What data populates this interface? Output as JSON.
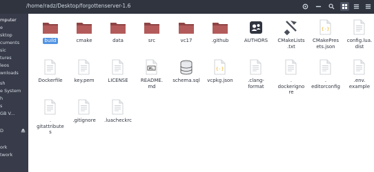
{
  "toolbar": {
    "path": "/home/radz/Desktop/forgottenserver-1.6",
    "buttons": [
      {
        "name": "view-options-icon"
      },
      {
        "name": "zoom-out-icon"
      },
      {
        "name": "search-icon"
      },
      {
        "name": "icon-view-icon"
      },
      {
        "name": "list-view-icon"
      },
      {
        "name": "menu-icon"
      }
    ]
  },
  "sidebar": {
    "items": [
      "mputer",
      "e",
      "sktop",
      "cuments",
      "sic",
      "tures",
      "leos",
      "wnloads",
      "sh",
      "e System",
      "h",
      "s",
      "GB V...",
      "D",
      "ork",
      "twork"
    ]
  },
  "files": [
    {
      "label": "build",
      "type": "folder",
      "selected": true
    },
    {
      "label": "cmake",
      "type": "folder"
    },
    {
      "label": "data",
      "type": "folder"
    },
    {
      "label": "src",
      "type": "folder"
    },
    {
      "label": "vc17",
      "type": "folder"
    },
    {
      "label": ".github",
      "type": "folder"
    },
    {
      "label": "AUTHORS",
      "type": "authors"
    },
    {
      "label": "CMakeLists\n.txt",
      "type": "cmake"
    },
    {
      "label": "CMakePres\nets.json",
      "type": "json"
    },
    {
      "label": "config.lua.\ndist",
      "type": "text"
    },
    {
      "label": "Dockerfile",
      "type": "text"
    },
    {
      "label": "key.pem",
      "type": "text"
    },
    {
      "label": "LICENSE",
      "type": "text"
    },
    {
      "label": "README.\nmd",
      "type": "markdown"
    },
    {
      "label": "schema.sql",
      "type": "sql"
    },
    {
      "label": "vcpkg.json",
      "type": "json"
    },
    {
      "label": ".clang-\nformat",
      "type": "text"
    },
    {
      "label": ".\ndockerigno\nre",
      "type": "text"
    },
    {
      "label": ".\neditorconfig",
      "type": "text"
    },
    {
      "label": ".env.\nexample",
      "type": "text"
    },
    {
      "label": ".\ngitattribute\ns",
      "type": "text"
    },
    {
      "label": ".gitignore",
      "type": "text"
    },
    {
      "label": ".luacheckrc",
      "type": "text"
    }
  ],
  "colors": {
    "folder": "#b35a5a",
    "folder_dark": "#8f4444",
    "selection": "#5294e2",
    "toolbar": "#2f343f",
    "sidebar": "#383c4a"
  }
}
